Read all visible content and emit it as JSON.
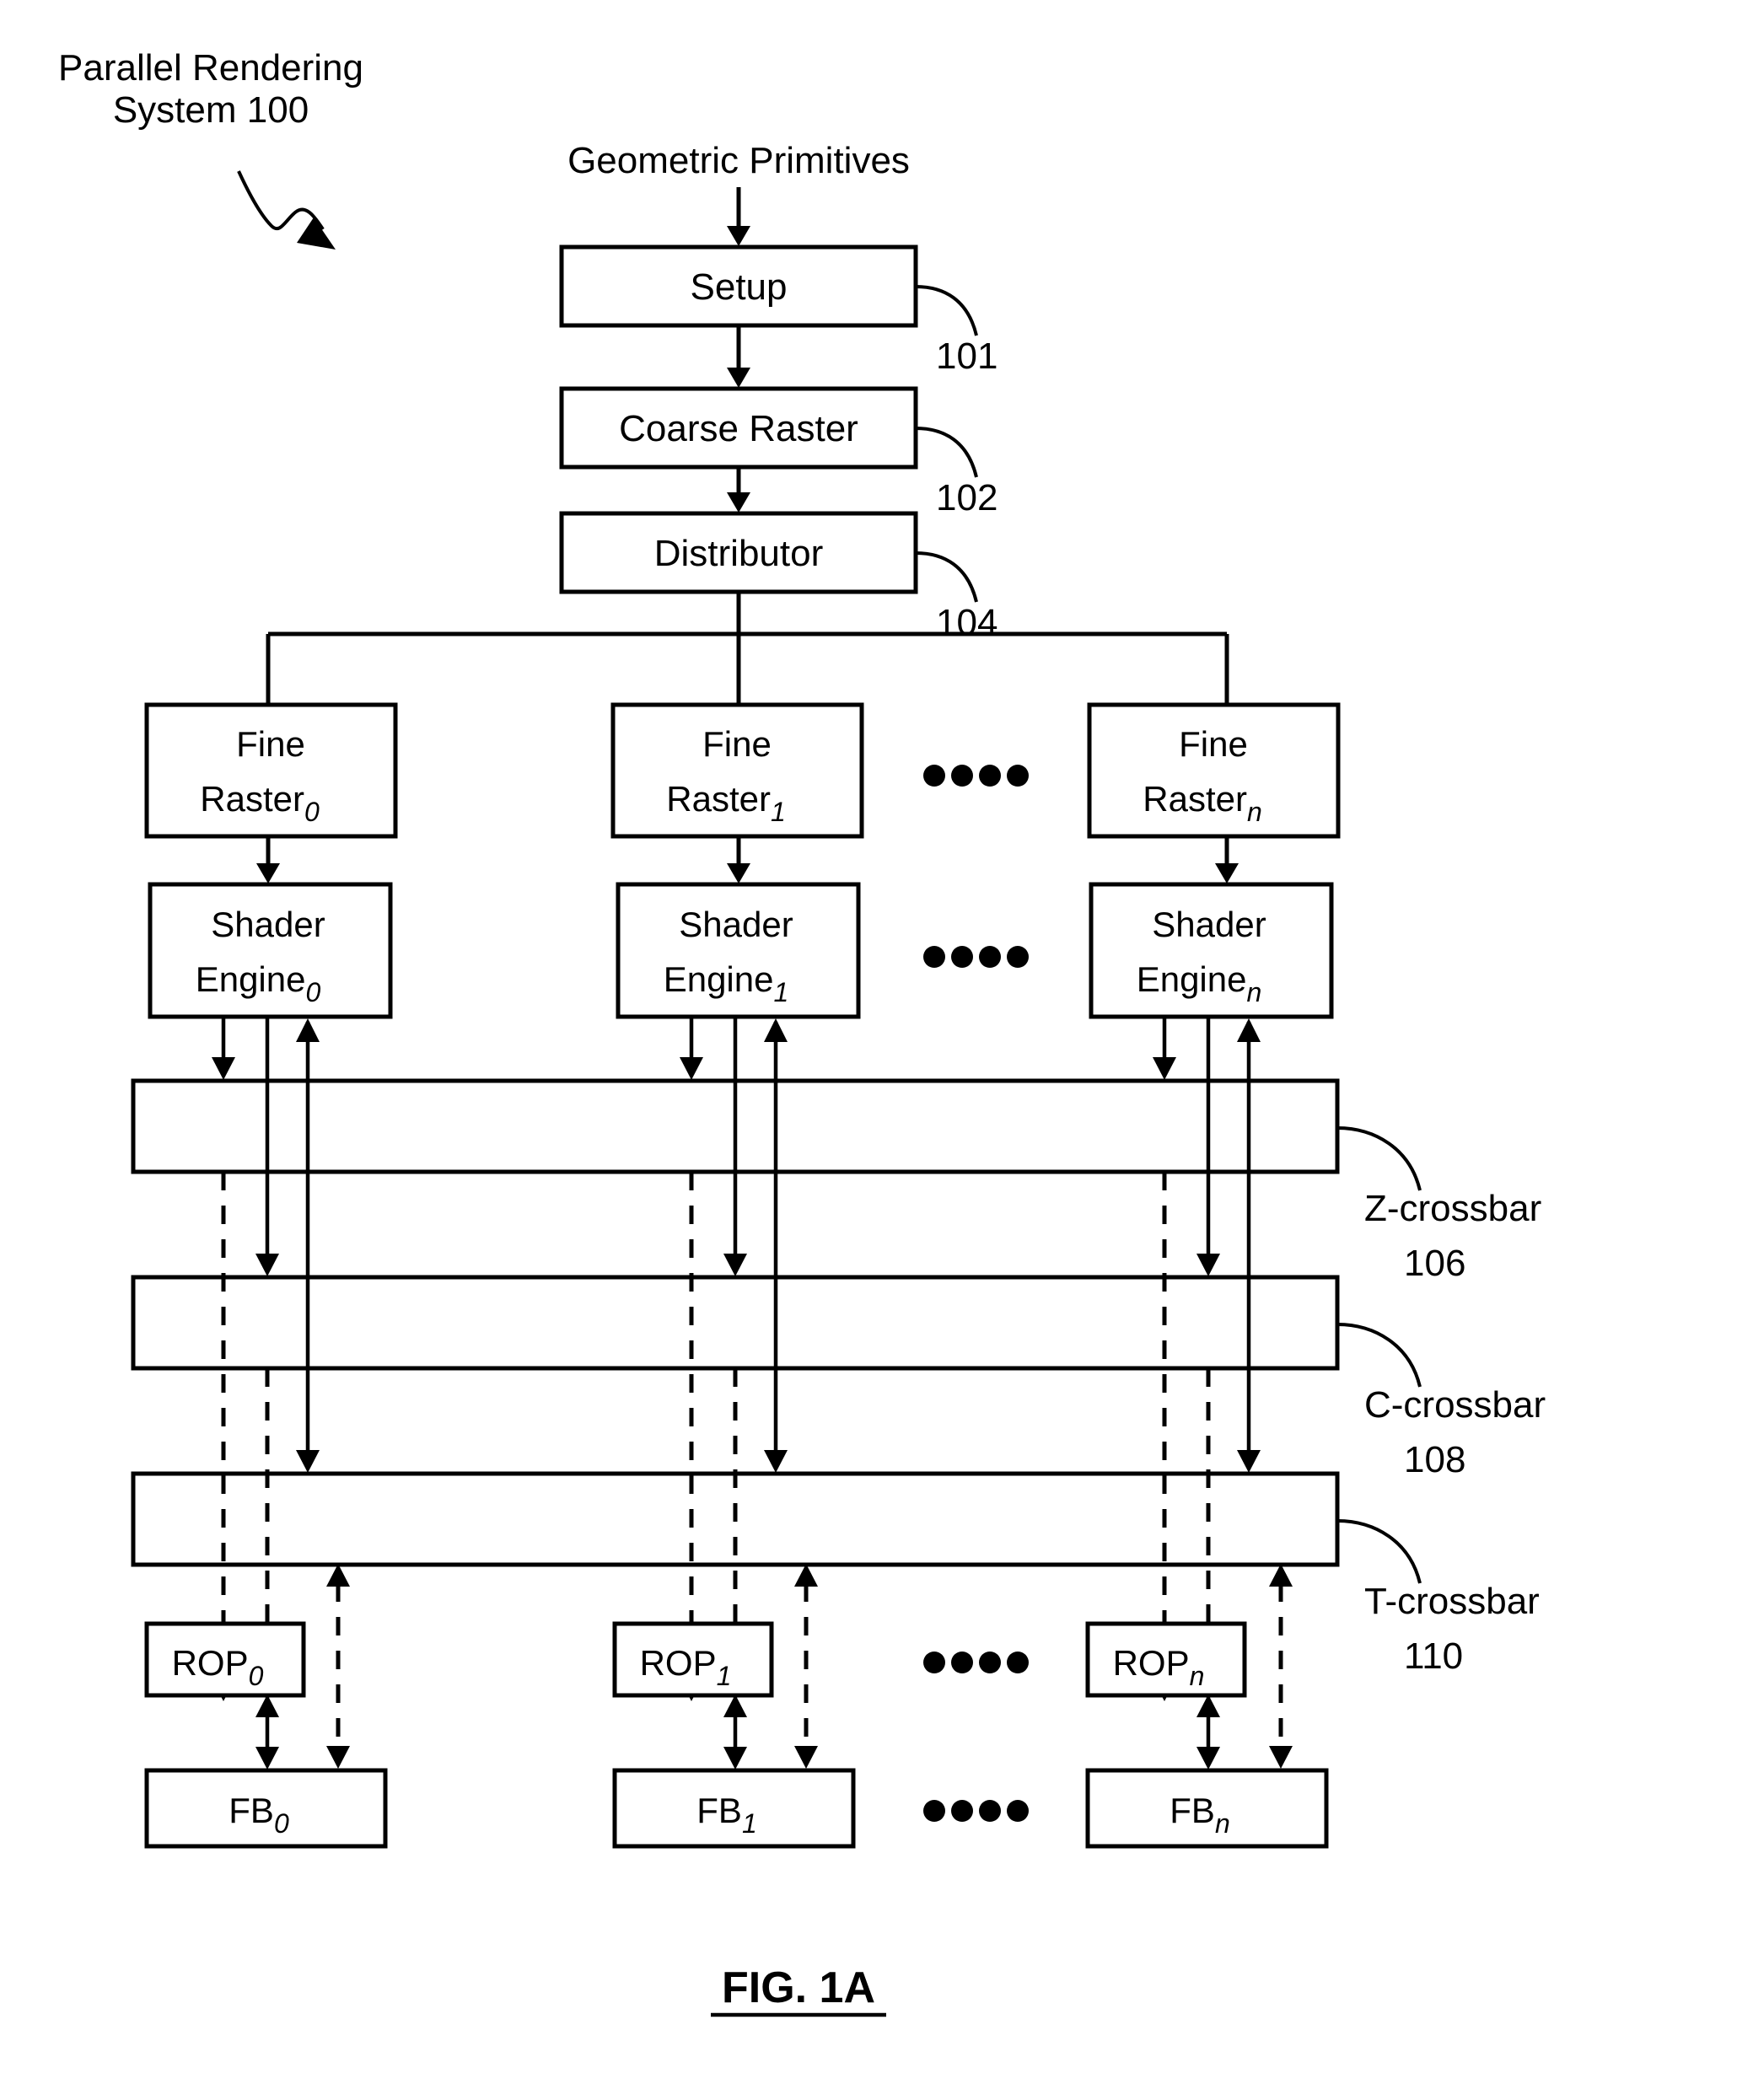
{
  "figure": {
    "caption": "FIG. 1A",
    "system_label_line1": "Parallel Rendering",
    "system_label_line2": "System 100",
    "input_label": "Geometric Primitives"
  },
  "pipeline": {
    "stages": [
      {
        "label": "Setup",
        "ref": "101"
      },
      {
        "label": "Coarse Raster",
        "ref": "102"
      },
      {
        "label": "Distributor",
        "ref": "104"
      }
    ]
  },
  "columns": [
    {
      "index": "0",
      "fine_raster_line1": "Fine",
      "fine_raster_line2": "Raster",
      "fine_raster_sub": "0",
      "shader_line1": "Shader",
      "shader_line2": "Engine",
      "shader_sub": "0",
      "rop": "ROP",
      "rop_sub": "0",
      "fb": "FB",
      "fb_sub": "0"
    },
    {
      "index": "1",
      "fine_raster_line1": "Fine",
      "fine_raster_line2": "Raster",
      "fine_raster_sub": "1",
      "shader_line1": "Shader",
      "shader_line2": "Engine",
      "shader_sub": "1",
      "rop": "ROP",
      "rop_sub": "1",
      "fb": "FB",
      "fb_sub": "1"
    },
    {
      "index": "n",
      "fine_raster_line1": "Fine",
      "fine_raster_line2": "Raster",
      "fine_raster_sub": "n",
      "shader_line1": "Shader",
      "shader_line2": "Engine",
      "shader_sub": "n",
      "rop": "ROP",
      "rop_sub": "n",
      "fb": "FB",
      "fb_sub": "n"
    }
  ],
  "crossbars": [
    {
      "name": "Z-crossbar",
      "ref": "106"
    },
    {
      "name": "C-crossbar",
      "ref": "108"
    },
    {
      "name": "T-crossbar",
      "ref": "110"
    }
  ],
  "ellipsis": {
    "glyph": "••••",
    "dot_count": 4
  },
  "style": {
    "line_color": "#000000",
    "fill_color": "#ffffff"
  }
}
